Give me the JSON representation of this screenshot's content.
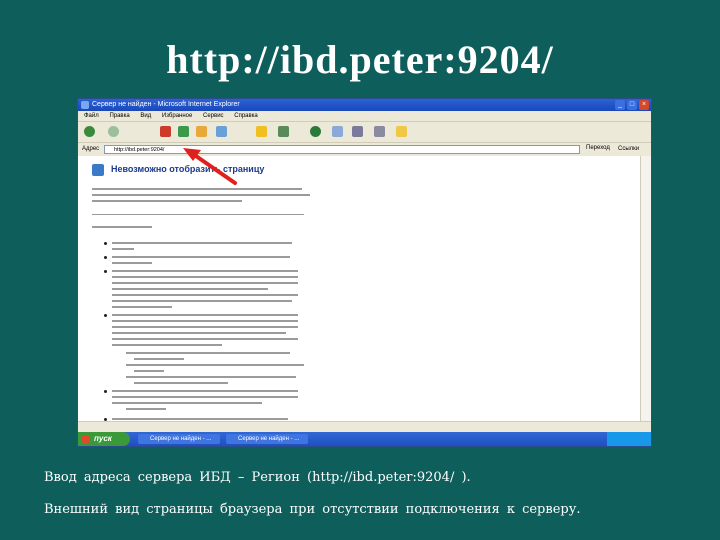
{
  "slide": {
    "title": "http://ibd.peter:9204/",
    "caption_line1": "Ввод адреса сервера ИБД – Регион (http://ibd.peter:9204/ ).",
    "caption_line2": "Внешний вид страницы браузера при отсутствии подключения к серверу."
  },
  "browser": {
    "window_title": "Сервер не найден - Microsoft Internet Explorer",
    "menu": [
      "Файл",
      "Правка",
      "Вид",
      "Избранное",
      "Сервис",
      "Справка"
    ],
    "address_label": "Адрес",
    "address_value": "http://ibd.peter:9204/",
    "go_label": "Переход",
    "links_label": "Ссылки",
    "error_heading": "Невозможно отобразить страницу",
    "start_label": "пуск",
    "taskbar_items": [
      "Сервер не найден - ...",
      "Сервер не найден - ..."
    ],
    "accent_color": "#e0201c",
    "icons": [
      "back-icon",
      "forward-icon",
      "stop-icon",
      "refresh-icon",
      "home-icon",
      "search-icon",
      "favorites-icon",
      "media-icon",
      "history-icon",
      "mail-icon",
      "print-icon",
      "edit-icon",
      "folder-icon"
    ]
  }
}
